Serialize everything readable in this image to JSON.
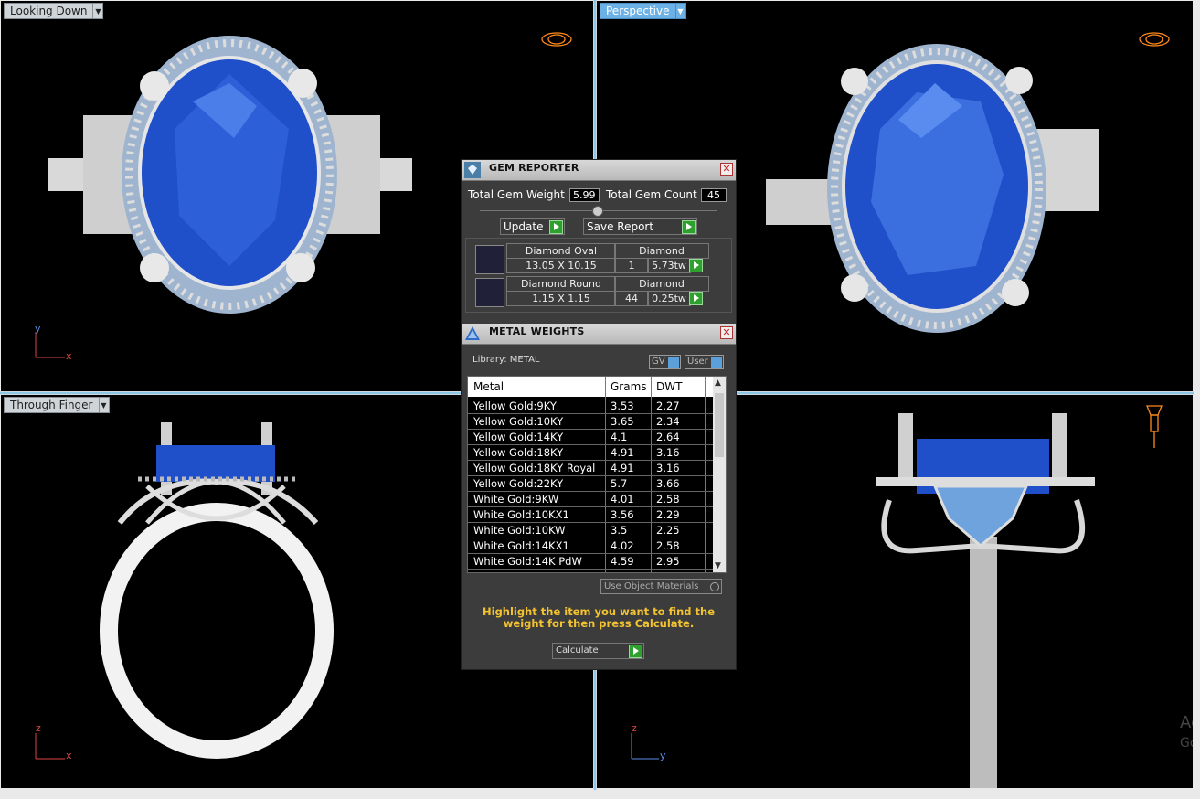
{
  "viewports": {
    "top_left": {
      "label": "Looking Down",
      "axis1": "y",
      "axis2": "x"
    },
    "top_right": {
      "label": "Perspective"
    },
    "bottom_left": {
      "label": "Through Finger",
      "axis1": "z",
      "axis2": "x"
    },
    "bottom_right": {
      "axis1": "z",
      "axis2": "y"
    }
  },
  "gem_reporter": {
    "title": "GEM REPORTER",
    "total_weight_label": "Total Gem Weight",
    "total_weight_value": "5.99",
    "total_count_label": "Total Gem Count",
    "total_count_value": "45",
    "update_label": "Update",
    "save_report_label": "Save Report",
    "rows": [
      {
        "shape": "Diamond Oval",
        "type": "Diamond",
        "size": "13.05 X 10.15",
        "count": "1",
        "weight": "5.73tw"
      },
      {
        "shape": "Diamond Round",
        "type": "Diamond",
        "size": "1.15 X 1.15",
        "count": "44",
        "weight": "0.25tw"
      }
    ]
  },
  "metal_weights": {
    "title": "METAL WEIGHTS",
    "library_label": "Library: METAL",
    "gv_label": "GV",
    "user_label": "User",
    "columns": [
      "Metal",
      "Grams",
      "DWT"
    ],
    "rows": [
      {
        "metal": "Yellow Gold:9KY",
        "grams": "3.53",
        "dwt": "2.27"
      },
      {
        "metal": "Yellow Gold:10KY",
        "grams": "3.65",
        "dwt": "2.34"
      },
      {
        "metal": "Yellow Gold:14KY",
        "grams": "4.1",
        "dwt": "2.64"
      },
      {
        "metal": "Yellow Gold:18KY",
        "grams": "4.91",
        "dwt": "3.16"
      },
      {
        "metal": "Yellow Gold:18KY Royal",
        "grams": "4.91",
        "dwt": "3.16"
      },
      {
        "metal": "Yellow Gold:22KY",
        "grams": "5.7",
        "dwt": "3.66"
      },
      {
        "metal": "White Gold:9KW",
        "grams": "4.01",
        "dwt": "2.58"
      },
      {
        "metal": "White Gold:10KX1",
        "grams": "3.56",
        "dwt": "2.29"
      },
      {
        "metal": "White Gold:10KW",
        "grams": "3.5",
        "dwt": "2.25"
      },
      {
        "metal": "White Gold:14KX1",
        "grams": "4.02",
        "dwt": "2.58"
      },
      {
        "metal": "White Gold:14K PdW",
        "grams": "4.59",
        "dwt": "2.95"
      }
    ],
    "use_object_materials_label": "Use Object Materials",
    "instruction": "Highlight the item you want to find the weight for then press Calculate.",
    "calculate_label": "Calculate"
  },
  "watermark": [
    "Ac",
    "Go"
  ],
  "colors": {
    "viewport_bg": "#000000",
    "gem_blue": "#1f4fc9",
    "accent_blue": "#6bb1e6",
    "panel_bg": "#3c3c3c",
    "instruction_text": "#f2c230",
    "go_green": "#2ea02e"
  }
}
